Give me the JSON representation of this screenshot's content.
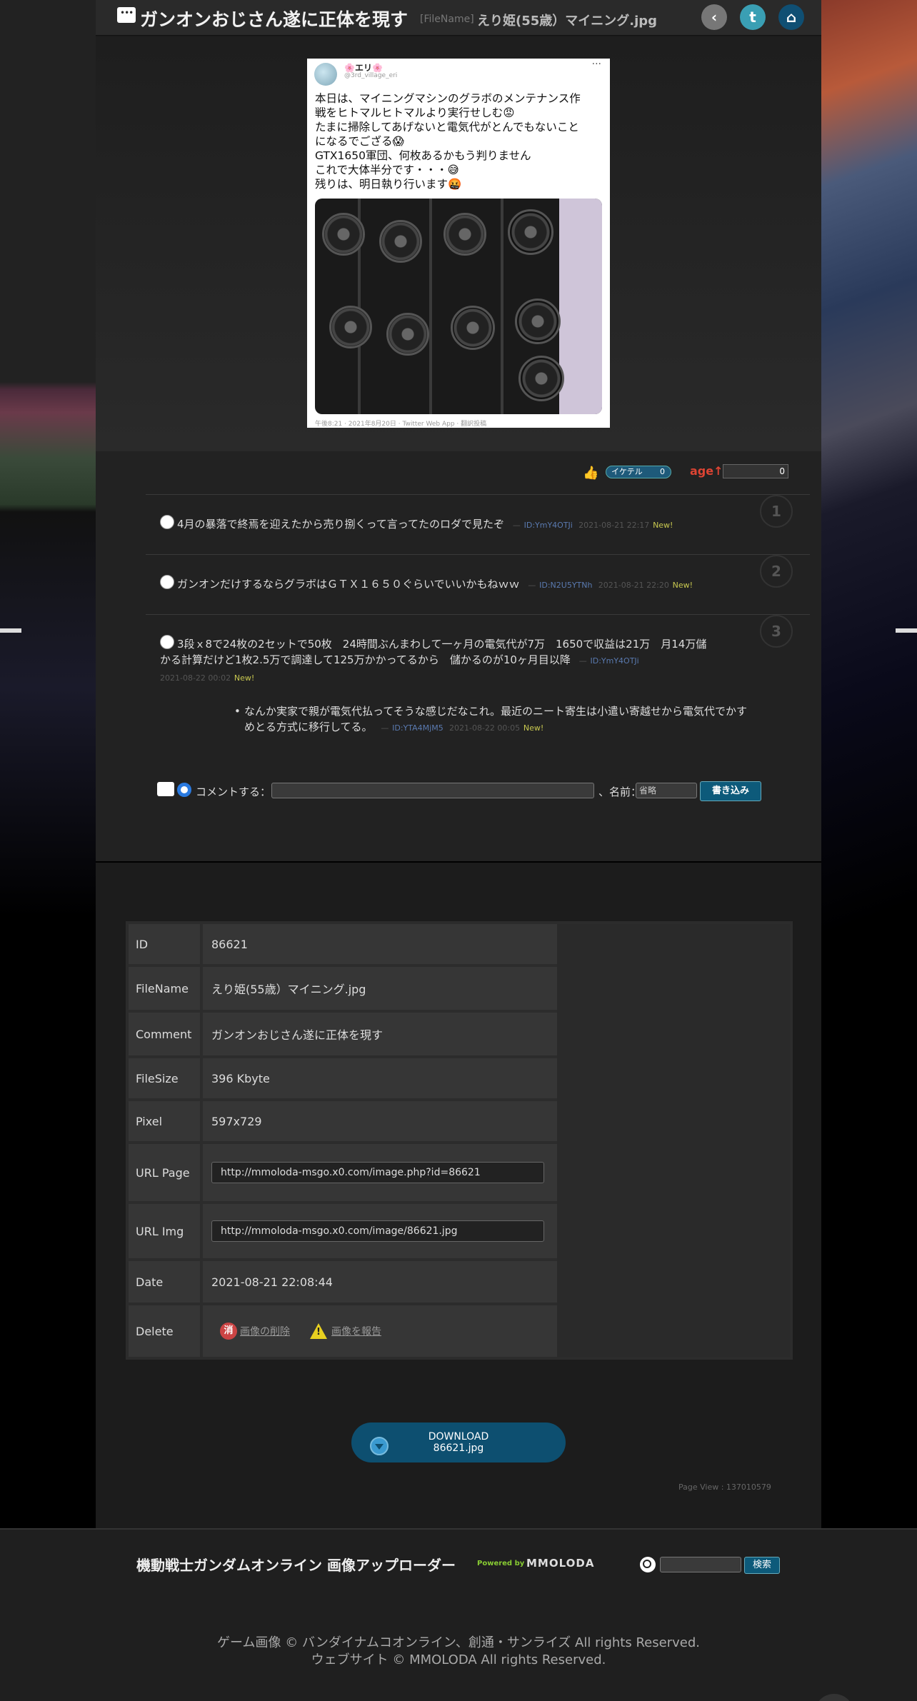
{
  "header": {
    "title": "ガンオンおじさん遂に正体を現す",
    "filename_label": "[FileName]",
    "filename": "えり姫(55歳）マイニング.jpg",
    "back_icon": "back-arrow-icon",
    "twitter_icon": "twitter-icon",
    "home_icon": "home-icon"
  },
  "tweet": {
    "user_name": "🌸エリ🌸",
    "handle": "@3rd_village_eri",
    "more": "···",
    "lines": [
      "本日は、マイニングマシンのグラボのメンテナンス作",
      "戦をヒトマルヒトマルより実行せしむ😡",
      "たまに掃除してあげないと電気代がとんでもないこと",
      "になるでござる😱",
      "GTX1650軍団、何枚あるかもう判りません",
      "これで大体半分です・・・😅",
      "残りは、明日執り行います🤬"
    ],
    "footer": "午後8:21 · 2021年8月20日 · Twitter Web App · 翻訳投稿"
  },
  "vote": {
    "ikete_label": "イケテル",
    "ikete_count": "0",
    "age_label": "age↑",
    "age_value": "0"
  },
  "responses": [
    {
      "num": "1",
      "text": "4月の暴落で終焉を迎えたから売り捌くって言ってたのロダで見たぞ",
      "sep": "—",
      "id": "ID:YmY4OTJi",
      "date": "2021-08-21 22:17",
      "new": "New!"
    },
    {
      "num": "2",
      "text": "ガンオンだけするならグラボはＧＴＸ１６５０ぐらいでいいかもねｗｗ",
      "sep": "—",
      "id": "ID:N2U5YTNh",
      "date": "2021-08-21 22:20",
      "new": "New!"
    },
    {
      "num": "3",
      "text_line1": "3段ｘ8で24枚の2セットで50枚　24時間ぶんまわして一ヶ月の電気代が7万　1650で収益は21万　月14万儲",
      "text_line2": "かる計算だけど1枚2.5万で調達して125万かかってるから　儲かるのが10ヶ月目以降",
      "sep": "—",
      "id": "ID:YmY4OTJi",
      "date": "2021-08-22 00:02",
      "new": "New!",
      "reply": {
        "line1": "なんか実家で親が電気代払ってそうな感じだなこれ。最近のニート寄生は小遣い寄越せから電気代でかす",
        "line2": "めとる方式に移行してる。",
        "sep": "—",
        "id": "ID:YTA4MjM5",
        "date": "2021-08-22 00:05",
        "new": "New!"
      }
    }
  ],
  "post_form": {
    "comment_label": "コメントする：",
    "name_label": "、名前：",
    "name_value": "省略",
    "submit_label": "書き込み"
  },
  "info": {
    "rows": [
      {
        "key": "ID",
        "value": "86621"
      },
      {
        "key": "FileName",
        "value": "えり姫(55歳）マイニング.jpg"
      },
      {
        "key": "Comment",
        "value": "ガンオンおじさん遂に正体を現す"
      },
      {
        "key": "FileSize",
        "value": "396 Kbyte"
      },
      {
        "key": "Pixel",
        "value": "597x729"
      },
      {
        "key": "URL Page",
        "value": "http://mmoloda-msgo.x0.com/image.php?id=86621"
      },
      {
        "key": "URL Img",
        "value": "http://mmoloda-msgo.x0.com/image/86621.jpg"
      },
      {
        "key": "Date",
        "value": "2021-08-21 22:08:44"
      },
      {
        "key": "Delete",
        "delete_icon": "消",
        "delete_label": "画像の削除",
        "report_label": "画像を報告"
      }
    ]
  },
  "download": {
    "line1": "DOWNLOAD",
    "line2": "86621.jpg"
  },
  "page_view": "Page View : 137010579",
  "footer": {
    "site_name": "機動戦士ガンダムオンライン 画像アップローダー",
    "powered_by": "Powered by",
    "brand": "MMOLODA",
    "search_button": "検索",
    "copyright1": "ゲーム画像 © バンダイナムコオンライン、創通・サンライズ All rights Reserved.",
    "copyright2": "ウェブサイト © MMOLODA All rights Reserved."
  }
}
